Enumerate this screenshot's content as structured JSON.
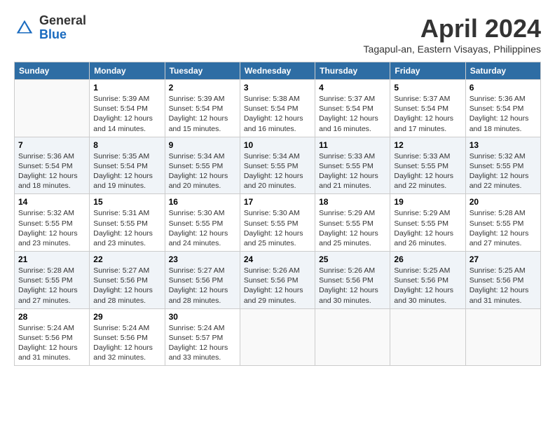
{
  "header": {
    "logo_line1": "General",
    "logo_line2": "Blue",
    "month_year": "April 2024",
    "location": "Tagapul-an, Eastern Visayas, Philippines"
  },
  "weekdays": [
    "Sunday",
    "Monday",
    "Tuesday",
    "Wednesday",
    "Thursday",
    "Friday",
    "Saturday"
  ],
  "weeks": [
    [
      {
        "day": null
      },
      {
        "day": "1",
        "sunrise": "5:39 AM",
        "sunset": "5:54 PM",
        "daylight": "12 hours and 14 minutes."
      },
      {
        "day": "2",
        "sunrise": "5:39 AM",
        "sunset": "5:54 PM",
        "daylight": "12 hours and 15 minutes."
      },
      {
        "day": "3",
        "sunrise": "5:38 AM",
        "sunset": "5:54 PM",
        "daylight": "12 hours and 16 minutes."
      },
      {
        "day": "4",
        "sunrise": "5:37 AM",
        "sunset": "5:54 PM",
        "daylight": "12 hours and 16 minutes."
      },
      {
        "day": "5",
        "sunrise": "5:37 AM",
        "sunset": "5:54 PM",
        "daylight": "12 hours and 17 minutes."
      },
      {
        "day": "6",
        "sunrise": "5:36 AM",
        "sunset": "5:54 PM",
        "daylight": "12 hours and 18 minutes."
      }
    ],
    [
      {
        "day": "7",
        "sunrise": "5:36 AM",
        "sunset": "5:54 PM",
        "daylight": "12 hours and 18 minutes."
      },
      {
        "day": "8",
        "sunrise": "5:35 AM",
        "sunset": "5:54 PM",
        "daylight": "12 hours and 19 minutes."
      },
      {
        "day": "9",
        "sunrise": "5:34 AM",
        "sunset": "5:55 PM",
        "daylight": "12 hours and 20 minutes."
      },
      {
        "day": "10",
        "sunrise": "5:34 AM",
        "sunset": "5:55 PM",
        "daylight": "12 hours and 20 minutes."
      },
      {
        "day": "11",
        "sunrise": "5:33 AM",
        "sunset": "5:55 PM",
        "daylight": "12 hours and 21 minutes."
      },
      {
        "day": "12",
        "sunrise": "5:33 AM",
        "sunset": "5:55 PM",
        "daylight": "12 hours and 22 minutes."
      },
      {
        "day": "13",
        "sunrise": "5:32 AM",
        "sunset": "5:55 PM",
        "daylight": "12 hours and 22 minutes."
      }
    ],
    [
      {
        "day": "14",
        "sunrise": "5:32 AM",
        "sunset": "5:55 PM",
        "daylight": "12 hours and 23 minutes."
      },
      {
        "day": "15",
        "sunrise": "5:31 AM",
        "sunset": "5:55 PM",
        "daylight": "12 hours and 23 minutes."
      },
      {
        "day": "16",
        "sunrise": "5:30 AM",
        "sunset": "5:55 PM",
        "daylight": "12 hours and 24 minutes."
      },
      {
        "day": "17",
        "sunrise": "5:30 AM",
        "sunset": "5:55 PM",
        "daylight": "12 hours and 25 minutes."
      },
      {
        "day": "18",
        "sunrise": "5:29 AM",
        "sunset": "5:55 PM",
        "daylight": "12 hours and 25 minutes."
      },
      {
        "day": "19",
        "sunrise": "5:29 AM",
        "sunset": "5:55 PM",
        "daylight": "12 hours and 26 minutes."
      },
      {
        "day": "20",
        "sunrise": "5:28 AM",
        "sunset": "5:55 PM",
        "daylight": "12 hours and 27 minutes."
      }
    ],
    [
      {
        "day": "21",
        "sunrise": "5:28 AM",
        "sunset": "5:55 PM",
        "daylight": "12 hours and 27 minutes."
      },
      {
        "day": "22",
        "sunrise": "5:27 AM",
        "sunset": "5:56 PM",
        "daylight": "12 hours and 28 minutes."
      },
      {
        "day": "23",
        "sunrise": "5:27 AM",
        "sunset": "5:56 PM",
        "daylight": "12 hours and 28 minutes."
      },
      {
        "day": "24",
        "sunrise": "5:26 AM",
        "sunset": "5:56 PM",
        "daylight": "12 hours and 29 minutes."
      },
      {
        "day": "25",
        "sunrise": "5:26 AM",
        "sunset": "5:56 PM",
        "daylight": "12 hours and 30 minutes."
      },
      {
        "day": "26",
        "sunrise": "5:25 AM",
        "sunset": "5:56 PM",
        "daylight": "12 hours and 30 minutes."
      },
      {
        "day": "27",
        "sunrise": "5:25 AM",
        "sunset": "5:56 PM",
        "daylight": "12 hours and 31 minutes."
      }
    ],
    [
      {
        "day": "28",
        "sunrise": "5:24 AM",
        "sunset": "5:56 PM",
        "daylight": "12 hours and 31 minutes."
      },
      {
        "day": "29",
        "sunrise": "5:24 AM",
        "sunset": "5:56 PM",
        "daylight": "12 hours and 32 minutes."
      },
      {
        "day": "30",
        "sunrise": "5:24 AM",
        "sunset": "5:57 PM",
        "daylight": "12 hours and 33 minutes."
      },
      {
        "day": null
      },
      {
        "day": null
      },
      {
        "day": null
      },
      {
        "day": null
      }
    ]
  ]
}
